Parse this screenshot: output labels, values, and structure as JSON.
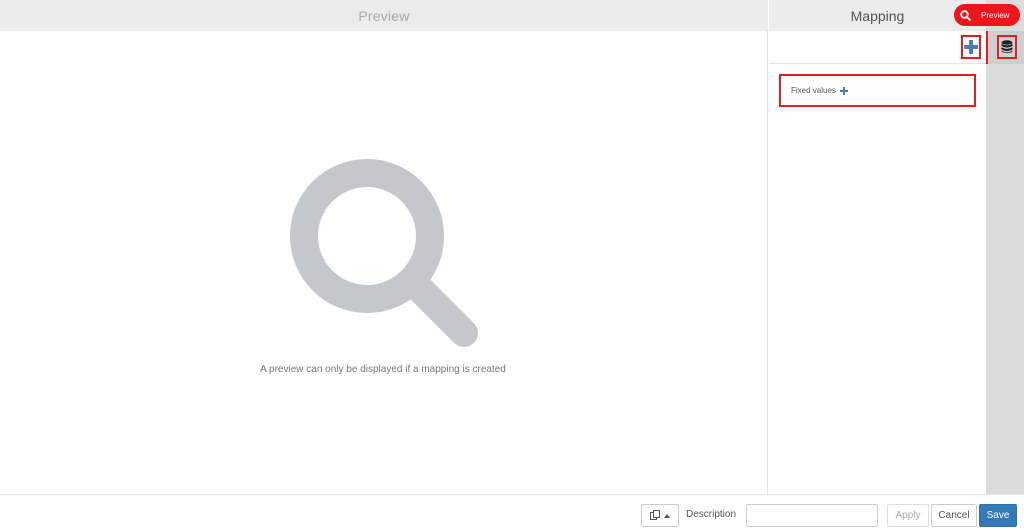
{
  "preview_pane": {
    "title": "Preview",
    "empty_message": "A preview can only be displayed if a mapping is created",
    "empty_icon": "search-icon"
  },
  "mapping_pane": {
    "title": "Mapping",
    "add_icon": "plus-icon",
    "fixed_values_label": "Fixed values",
    "fixed_values_icon": "plus-icon"
  },
  "right_rail": {
    "database_icon": "database-icon"
  },
  "preview_button": {
    "label": "Preview",
    "icon": "search-icon",
    "color": "#f0141c"
  },
  "footer": {
    "clipboard_icon": "clipboard-icon",
    "description_label": "Description",
    "description_value": "",
    "apply_label": "Apply",
    "cancel_label": "Cancel",
    "save_label": "Save"
  },
  "colors": {
    "accent_blue": "#337ab7",
    "highlight_red": "#e02020",
    "icon_gray": "#c4c7cc"
  }
}
